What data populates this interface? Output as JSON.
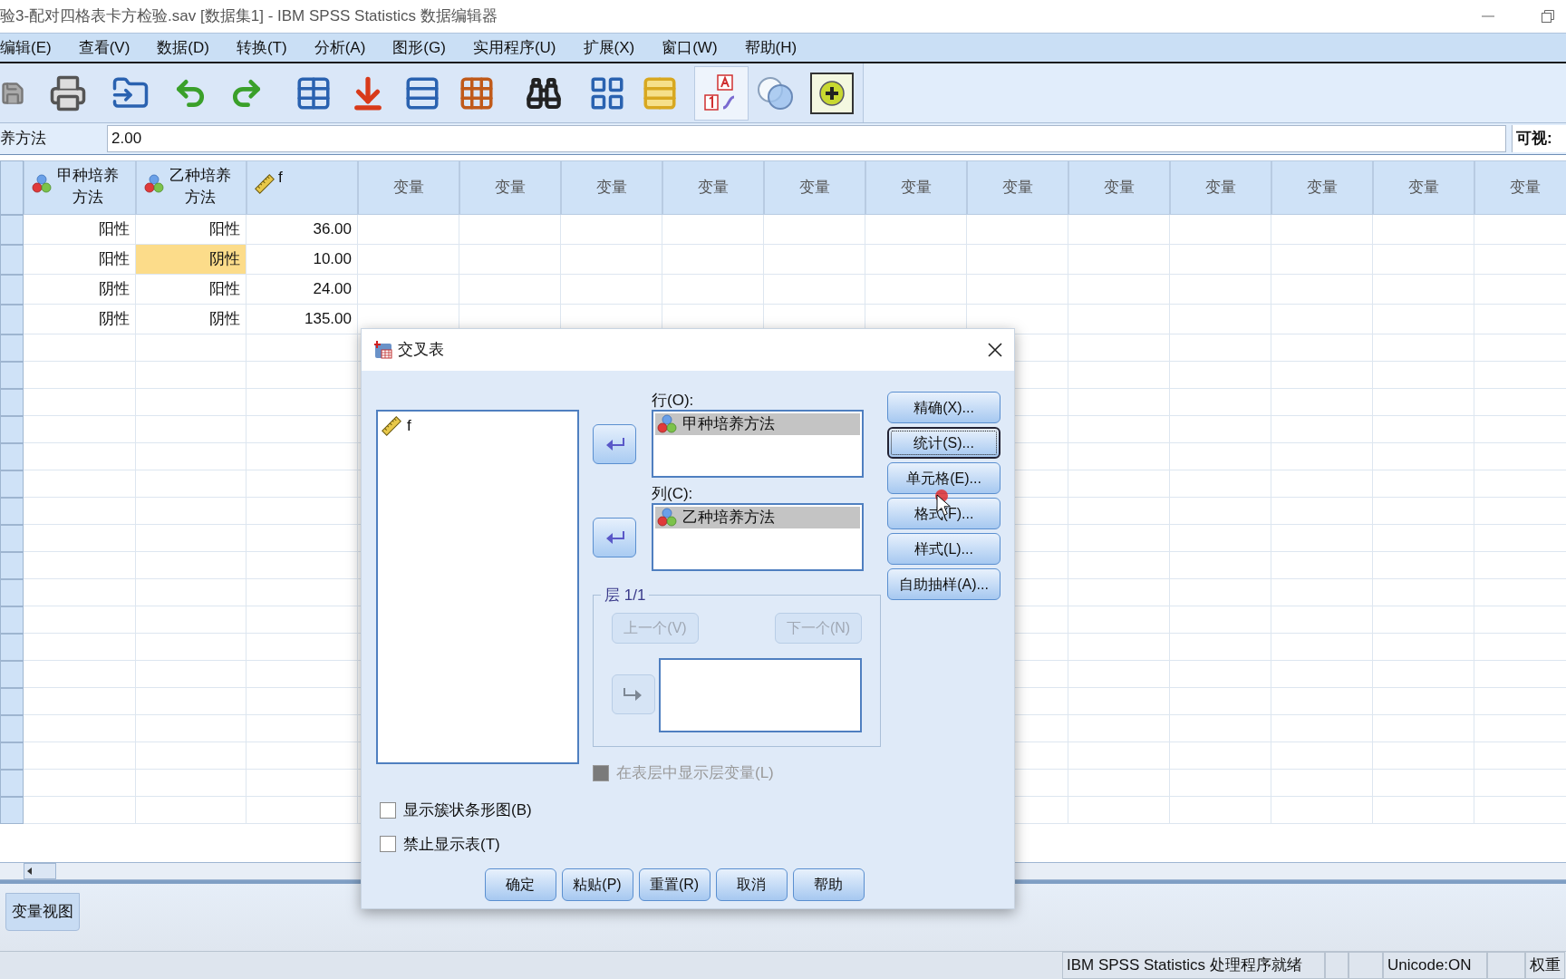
{
  "window": {
    "title": "验3-配对四格表卡方检验.sav [数据集1] - IBM SPSS Statistics 数据编辑器"
  },
  "menu": [
    "编辑(E)",
    "查看(V)",
    "数据(D)",
    "转换(T)",
    "分析(A)",
    "图形(G)",
    "实用程序(U)",
    "扩展(X)",
    "窗口(W)",
    "帮助(H)"
  ],
  "cell_editor": {
    "label": "养方法",
    "value": "2.00",
    "visible_label": "可视:"
  },
  "grid": {
    "columns": [
      {
        "label": "甲种培养方法",
        "kind": "nominal"
      },
      {
        "label": "乙种培养方法",
        "kind": "nominal"
      },
      {
        "label": "f",
        "kind": "scale"
      }
    ],
    "empty_columns": [
      "变量",
      "变量",
      "变量",
      "变量",
      "变量",
      "变量",
      "变量",
      "变量",
      "变量",
      "变量",
      "变量",
      "变量"
    ],
    "rows": [
      {
        "cells": [
          {
            "value": "阳性",
            "selected": false
          },
          {
            "value": "阳性",
            "selected": false
          },
          {
            "value": "36.00",
            "selected": false
          }
        ]
      },
      {
        "cells": [
          {
            "value": "阳性",
            "selected": false
          },
          {
            "value": "阴性",
            "selected": true
          },
          {
            "value": "10.00",
            "selected": false
          }
        ]
      },
      {
        "cells": [
          {
            "value": "阴性",
            "selected": false
          },
          {
            "value": "阳性",
            "selected": false
          },
          {
            "value": "24.00",
            "selected": false
          }
        ]
      },
      {
        "cells": [
          {
            "value": "阴性",
            "selected": false
          },
          {
            "value": "阴性",
            "selected": false
          },
          {
            "value": "135.00",
            "selected": false
          }
        ]
      }
    ]
  },
  "view_tabs": [
    {
      "label": "变量视图",
      "selected": false
    }
  ],
  "dialog": {
    "title": "交叉表",
    "source_list": [
      {
        "name": "f",
        "kind": "scale"
      }
    ],
    "rows_label": "行(O):",
    "rows": [
      {
        "name": "甲种培养方法",
        "kind": "nominal",
        "selected": true
      }
    ],
    "columns_label": "列(C):",
    "columns": [
      {
        "name": "乙种培养方法",
        "kind": "nominal",
        "selected": true
      }
    ],
    "side_buttons": [
      {
        "label": "精确(X)...",
        "focused": false
      },
      {
        "label": "统计(S)...",
        "focused": true
      },
      {
        "label": "单元格(E)...",
        "focused": false
      },
      {
        "label": "格式(F)...",
        "focused": false
      },
      {
        "label": "样式(L)...",
        "focused": false
      },
      {
        "label": "自助抽样(A)...",
        "focused": false
      }
    ],
    "layer": {
      "title": "层 1/1",
      "previous": {
        "label": "上一个(V)",
        "disabled": true
      },
      "next": {
        "label": "下一个(N)",
        "disabled": true
      },
      "arrow_disabled": true
    },
    "layer_option": {
      "label": "在表层中显示层变量(L)",
      "checked": false,
      "disabled": true
    },
    "options": [
      {
        "label": "显示簇状条形图(B)",
        "checked": false
      },
      {
        "label": "禁止显示表(T)",
        "checked": false
      }
    ],
    "buttons": [
      "确定",
      "粘贴(P)",
      "重置(R)",
      "取消",
      "帮助"
    ]
  },
  "status_bar": {
    "processor": "IBM SPSS Statistics 处理程序就绪",
    "unicode": "Unicode:ON",
    "weight": "权重"
  }
}
